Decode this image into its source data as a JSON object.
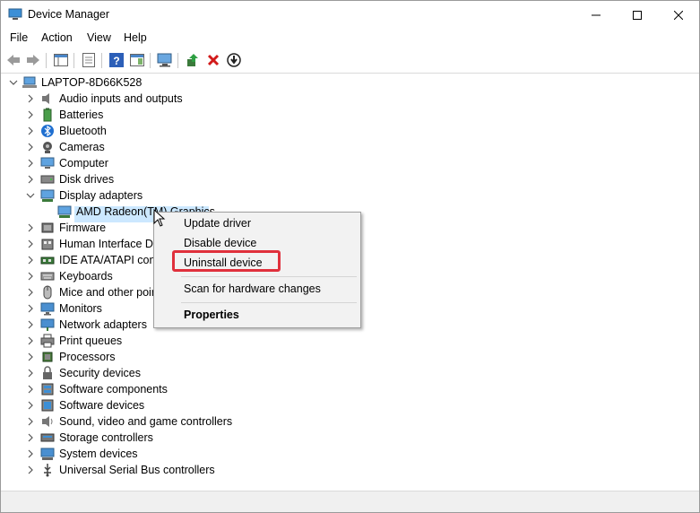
{
  "window": {
    "title": "Device Manager"
  },
  "menu": [
    "File",
    "Action",
    "View",
    "Help"
  ],
  "tree": {
    "root": "LAPTOP-8D66K528",
    "categories": [
      {
        "label": "Audio inputs and outputs",
        "icon": "speaker-icon"
      },
      {
        "label": "Batteries",
        "icon": "battery-icon"
      },
      {
        "label": "Bluetooth",
        "icon": "bluetooth-icon"
      },
      {
        "label": "Cameras",
        "icon": "camera-icon"
      },
      {
        "label": "Computer",
        "icon": "computer-icon"
      },
      {
        "label": "Disk drives",
        "icon": "disk-icon"
      },
      {
        "label": "Display adapters",
        "icon": "display-adapter-icon",
        "expanded": true
      },
      {
        "label": "Firmware",
        "icon": "firmware-icon"
      },
      {
        "label": "Human Interface De",
        "icon": "hid-icon"
      },
      {
        "label": "IDE ATA/ATAPI contr",
        "icon": "ide-icon"
      },
      {
        "label": "Keyboards",
        "icon": "keyboard-icon"
      },
      {
        "label": "Mice and other poir",
        "icon": "mouse-icon"
      },
      {
        "label": "Monitors",
        "icon": "monitor-icon"
      },
      {
        "label": "Network adapters",
        "icon": "network-icon"
      },
      {
        "label": "Print queues",
        "icon": "printer-icon"
      },
      {
        "label": "Processors",
        "icon": "processor-icon"
      },
      {
        "label": "Security devices",
        "icon": "security-icon"
      },
      {
        "label": "Software components",
        "icon": "software-component-icon"
      },
      {
        "label": "Software devices",
        "icon": "software-device-icon"
      },
      {
        "label": "Sound, video and game controllers",
        "icon": "sound-icon"
      },
      {
        "label": "Storage controllers",
        "icon": "storage-icon"
      },
      {
        "label": "System devices",
        "icon": "system-icon"
      },
      {
        "label": "Universal Serial Bus controllers",
        "icon": "usb-icon"
      }
    ],
    "child": "AMD Radeon(TM) Graphics"
  },
  "context_menu": {
    "update": "Update driver",
    "disable": "Disable device",
    "uninstall": "Uninstall device",
    "scan": "Scan for hardware changes",
    "properties": "Properties"
  },
  "colors": {
    "selection": "#cce8ff",
    "highlight": "#e0303c"
  }
}
